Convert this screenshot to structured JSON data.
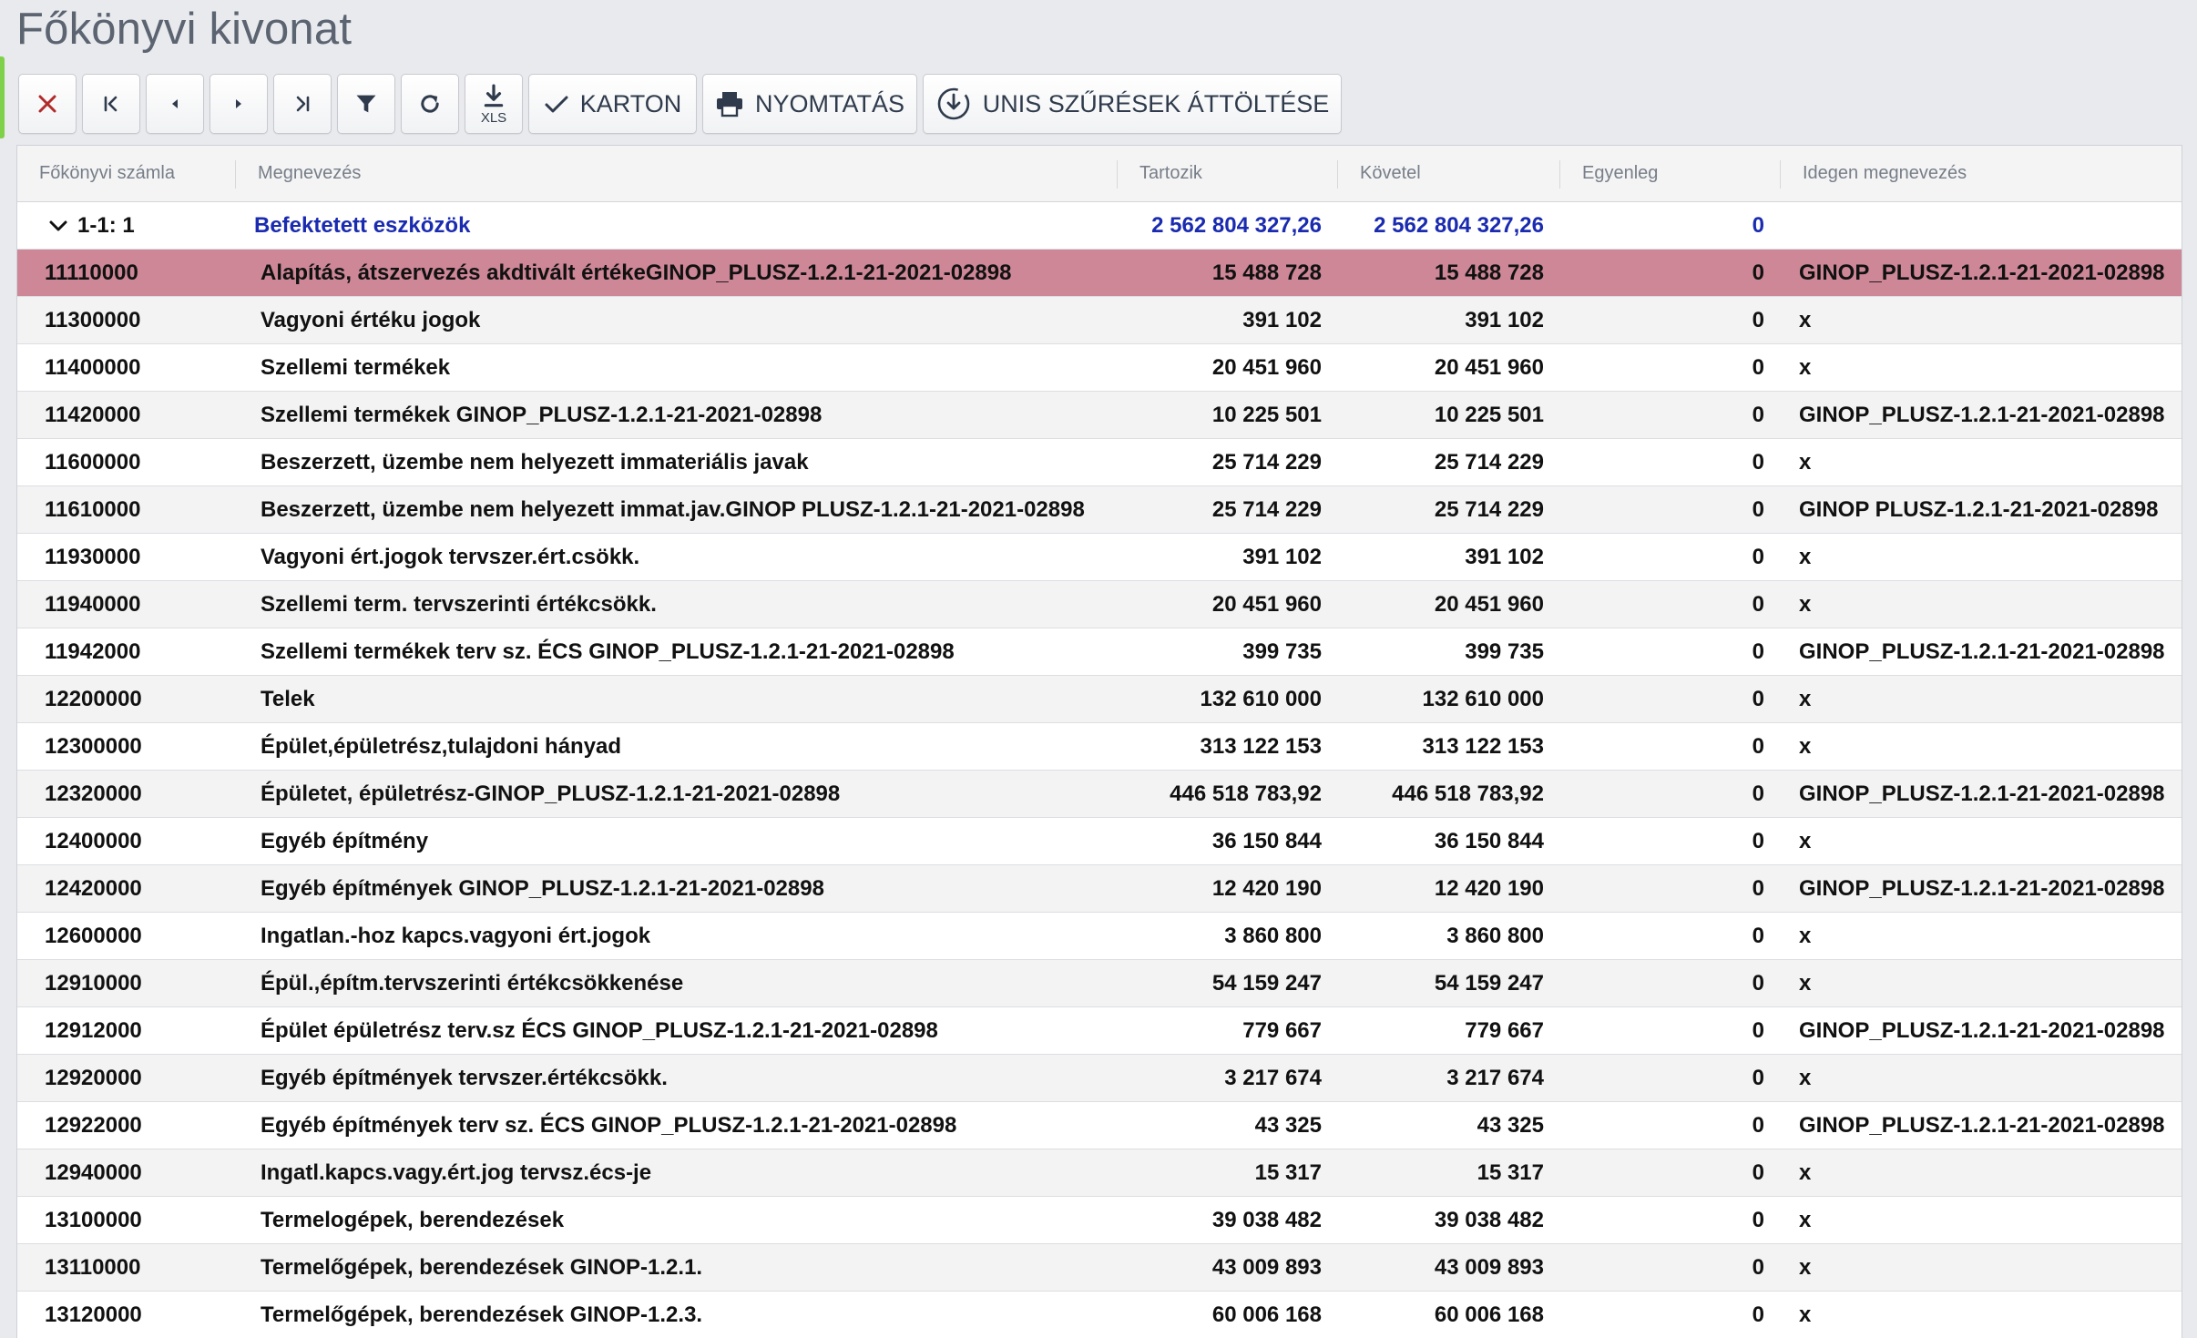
{
  "page_title": "Főkönyvi kivonat",
  "toolbar": {
    "close_icon": "close-icon",
    "first_icon": "first-page-icon",
    "prev_icon": "prev-icon",
    "next_icon": "next-icon",
    "last_icon": "last-page-icon",
    "filter_icon": "filter-icon",
    "refresh_icon": "refresh-icon",
    "xls_label": "XLS",
    "karton_label": "KARTON",
    "print_label": "NYOMTATÁS",
    "unis_label": "UNIS SZŰRÉSEK ÁTTÖLTÉSE"
  },
  "columns": {
    "account": "Főkönyvi számla",
    "name": "Megnevezés",
    "debit": "Tartozik",
    "credit": "Követel",
    "balance": "Egyenleg",
    "foreign_name": "Idegen megnevezés"
  },
  "group": {
    "label": "1-1: 1",
    "name": "Befektetett eszközök",
    "debit": "2 562 804 327,26",
    "credit": "2 562 804 327,26",
    "balance": "0"
  },
  "colors": {
    "selected_row": "#cd8797",
    "group_text": "#1a2bb0"
  },
  "rows": [
    {
      "account": "11110000",
      "name": "Alapítás, átszervezés akdtivált értékeGINOP_PLUSZ-1.2.1-21-2021-02898",
      "debit": "15 488 728",
      "credit": "15 488 728",
      "balance": "0",
      "foreign": "GINOP_PLUSZ-1.2.1-21-2021-02898",
      "selected": true
    },
    {
      "account": "11300000",
      "name": "Vagyoni értéku jogok",
      "debit": "391 102",
      "credit": "391 102",
      "balance": "0",
      "foreign": "x"
    },
    {
      "account": "11400000",
      "name": "Szellemi termékek",
      "debit": "20 451 960",
      "credit": "20 451 960",
      "balance": "0",
      "foreign": "x"
    },
    {
      "account": "11420000",
      "name": "Szellemi termékek GINOP_PLUSZ-1.2.1-21-2021-02898",
      "debit": "10 225 501",
      "credit": "10 225 501",
      "balance": "0",
      "foreign": "GINOP_PLUSZ-1.2.1-21-2021-02898"
    },
    {
      "account": "11600000",
      "name": "Beszerzett, üzembe nem helyezett immateriális javak",
      "debit": "25 714 229",
      "credit": "25 714 229",
      "balance": "0",
      "foreign": "x"
    },
    {
      "account": "11610000",
      "name": "Beszerzett, üzembe nem helyezett immat.jav.GINOP PLUSZ-1.2.1-21-2021-02898",
      "debit": "25 714 229",
      "credit": "25 714 229",
      "balance": "0",
      "foreign": "GINOP PLUSZ-1.2.1-21-2021-02898"
    },
    {
      "account": "11930000",
      "name": "Vagyoni ért.jogok tervszer.ért.csökk.",
      "debit": "391 102",
      "credit": "391 102",
      "balance": "0",
      "foreign": "x"
    },
    {
      "account": "11940000",
      "name": "Szellemi term. tervszerinti értékcsökk.",
      "debit": "20 451 960",
      "credit": "20 451 960",
      "balance": "0",
      "foreign": "x"
    },
    {
      "account": "11942000",
      "name": "Szellemi termékek terv sz. ÉCS GINOP_PLUSZ-1.2.1-21-2021-02898",
      "debit": "399 735",
      "credit": "399 735",
      "balance": "0",
      "foreign": "GINOP_PLUSZ-1.2.1-21-2021-02898"
    },
    {
      "account": "12200000",
      "name": "Telek",
      "debit": "132 610 000",
      "credit": "132 610 000",
      "balance": "0",
      "foreign": "x"
    },
    {
      "account": "12300000",
      "name": "Épület,épületrész,tulajdoni hányad",
      "debit": "313 122 153",
      "credit": "313 122 153",
      "balance": "0",
      "foreign": "x"
    },
    {
      "account": "12320000",
      "name": "Épületet, épületrész-GINOP_PLUSZ-1.2.1-21-2021-02898",
      "debit": "446 518 783,92",
      "credit": "446 518 783,92",
      "balance": "0",
      "foreign": "GINOP_PLUSZ-1.2.1-21-2021-02898"
    },
    {
      "account": "12400000",
      "name": "Egyéb építmény",
      "debit": "36 150 844",
      "credit": "36 150 844",
      "balance": "0",
      "foreign": "x"
    },
    {
      "account": "12420000",
      "name": "Egyéb építmények GINOP_PLUSZ-1.2.1-21-2021-02898",
      "debit": "12 420 190",
      "credit": "12 420 190",
      "balance": "0",
      "foreign": "GINOP_PLUSZ-1.2.1-21-2021-02898"
    },
    {
      "account": "12600000",
      "name": "Ingatlan.-hoz kapcs.vagyoni ért.jogok",
      "debit": "3 860 800",
      "credit": "3 860 800",
      "balance": "0",
      "foreign": "x"
    },
    {
      "account": "12910000",
      "name": "Épül.,építm.tervszerinti értékcsökkenése",
      "debit": "54 159 247",
      "credit": "54 159 247",
      "balance": "0",
      "foreign": "x"
    },
    {
      "account": "12912000",
      "name": "Épület épületrész terv.sz ÉCS GINOP_PLUSZ-1.2.1-21-2021-02898",
      "debit": "779 667",
      "credit": "779 667",
      "balance": "0",
      "foreign": "GINOP_PLUSZ-1.2.1-21-2021-02898"
    },
    {
      "account": "12920000",
      "name": "Egyéb építmények tervszer.értékcsökk.",
      "debit": "3 217 674",
      "credit": "3 217 674",
      "balance": "0",
      "foreign": "x"
    },
    {
      "account": "12922000",
      "name": "Egyéb építmények terv sz. ÉCS GINOP_PLUSZ-1.2.1-21-2021-02898",
      "debit": "43 325",
      "credit": "43 325",
      "balance": "0",
      "foreign": "GINOP_PLUSZ-1.2.1-21-2021-02898"
    },
    {
      "account": "12940000",
      "name": "Ingatl.kapcs.vagy.ért.jog tervsz.écs-je",
      "debit": "15 317",
      "credit": "15 317",
      "balance": "0",
      "foreign": "x"
    },
    {
      "account": "13100000",
      "name": "Termelogépek, berendezések",
      "debit": "39 038 482",
      "credit": "39 038 482",
      "balance": "0",
      "foreign": "x"
    },
    {
      "account": "13110000",
      "name": "Termelőgépek, berendezések GINOP-1.2.1.",
      "debit": "43 009 893",
      "credit": "43 009 893",
      "balance": "0",
      "foreign": "x"
    },
    {
      "account": "13120000",
      "name": "Termelőgépek, berendezések GINOP-1.2.3.",
      "debit": "60 006 168",
      "credit": "60 006 168",
      "balance": "0",
      "foreign": "x"
    }
  ]
}
